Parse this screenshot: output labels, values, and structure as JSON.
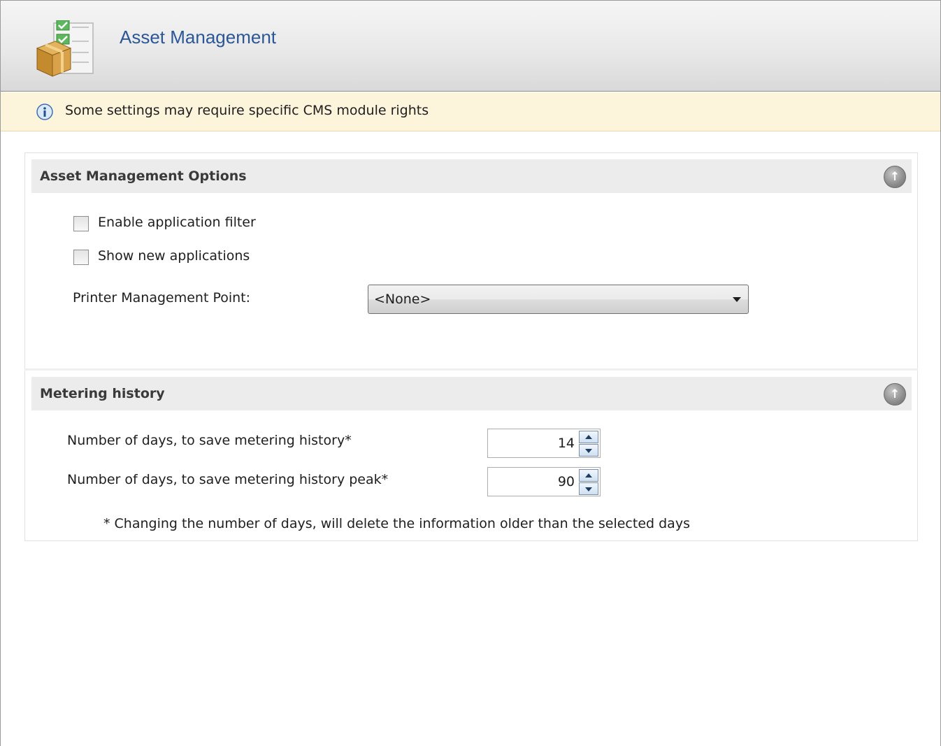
{
  "header": {
    "title": "Asset Management",
    "icon": "asset-management-icon"
  },
  "info_bar": {
    "icon": "info-icon",
    "text": "Some settings may require specific CMS module rights"
  },
  "sections": {
    "options": {
      "title": "Asset Management Options",
      "collapse_icon": "collapse-up-icon",
      "enable_filter": {
        "label": "Enable application filter",
        "checked": false
      },
      "show_new_apps": {
        "label": "Show new applications",
        "checked": false
      },
      "printer_mp": {
        "label": "Printer Management Point:",
        "value": "<None>"
      }
    },
    "metering": {
      "title": "Metering history",
      "collapse_icon": "collapse-up-icon",
      "history_days": {
        "label": "Number of days, to save metering history*",
        "value": "14"
      },
      "peak_days": {
        "label": "Number of days, to save metering history peak*",
        "value": "90"
      },
      "footnote": "* Changing the number of days, will delete the information older than the selected days"
    }
  },
  "colors": {
    "title_blue": "#2b5797",
    "info_bg": "#fdf4dc",
    "section_header_bg": "#ececec"
  }
}
